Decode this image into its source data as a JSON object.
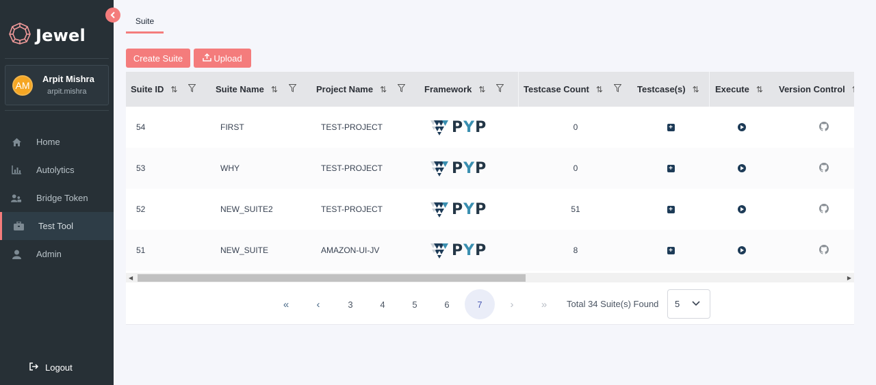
{
  "app": {
    "name": "Jewel"
  },
  "user": {
    "initials": "AM",
    "name": "Arpit Mishra",
    "handle": "arpit.mishra"
  },
  "nav": [
    {
      "label": "Home",
      "icon": "home-icon",
      "active": false
    },
    {
      "label": "Autolytics",
      "icon": "bar-chart-icon",
      "active": false
    },
    {
      "label": "Bridge Token",
      "icon": "users-key-icon",
      "active": false
    },
    {
      "label": "Test Tool",
      "icon": "toolbox-icon",
      "active": true
    },
    {
      "label": "Admin",
      "icon": "user-icon",
      "active": false
    }
  ],
  "logout_label": "Logout",
  "tab_label": "Suite",
  "actions": {
    "create_label": "Create Suite",
    "upload_label": "Upload"
  },
  "table": {
    "columns": [
      "Suite ID",
      "Suite Name",
      "Project Name",
      "Framework",
      "Testcase Count",
      "Testcase(s)",
      "Execute",
      "Version Control"
    ],
    "rows": [
      {
        "id": "54",
        "name": "FIRST",
        "project": "TEST-PROJECT",
        "framework": "PYP",
        "count": "0"
      },
      {
        "id": "53",
        "name": "WHY",
        "project": "TEST-PROJECT",
        "framework": "PYP",
        "count": "0"
      },
      {
        "id": "52",
        "name": "NEW_SUITE2",
        "project": "TEST-PROJECT",
        "framework": "PYP",
        "count": "51"
      },
      {
        "id": "51",
        "name": "NEW_SUITE",
        "project": "AMAZON-UI-JV",
        "framework": "PYP",
        "count": "8"
      }
    ]
  },
  "pagination": {
    "pages": [
      "3",
      "4",
      "5",
      "6",
      "7"
    ],
    "current": "7",
    "total_text": "Total 34 Suite(s) Found",
    "page_size": "5"
  },
  "colors": {
    "accent": "#f47c7c",
    "sidebar": "#273036",
    "header": "#e4e5e8",
    "icon_dark": "#1d3b57"
  }
}
